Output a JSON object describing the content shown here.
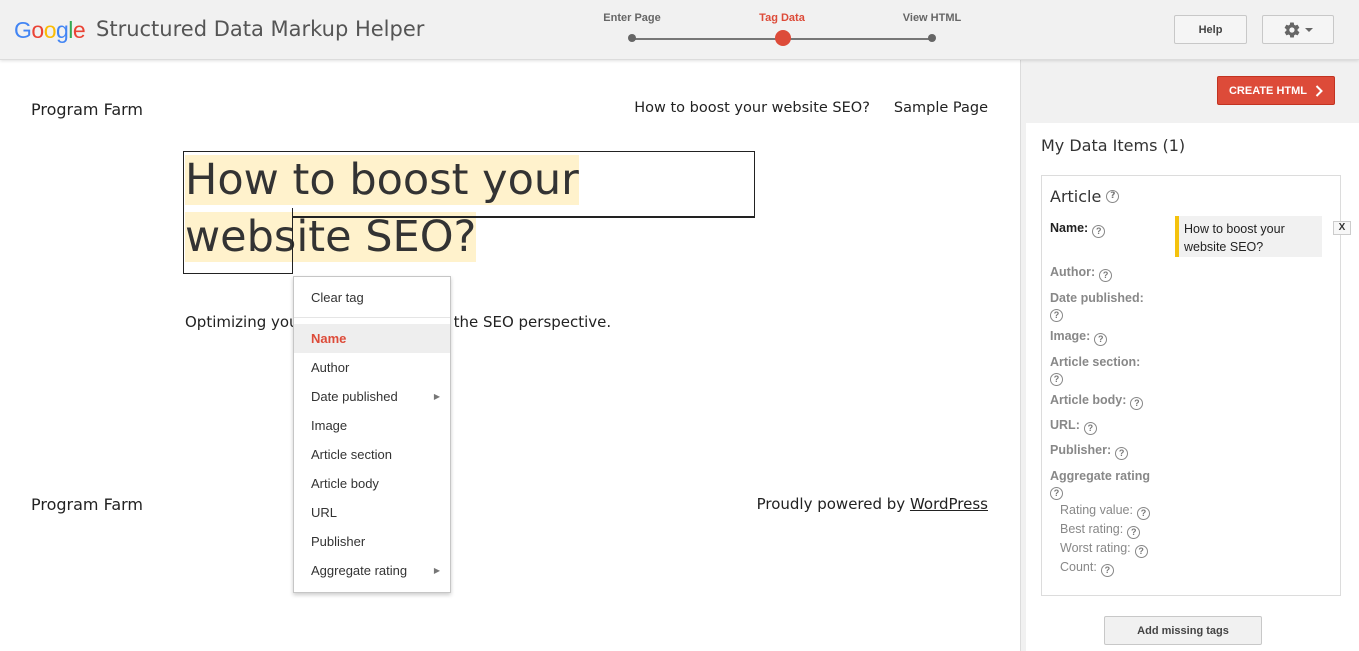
{
  "header": {
    "logo_letters": [
      {
        "char": "G",
        "color": "#4285F4"
      },
      {
        "char": "o",
        "color": "#EA4335"
      },
      {
        "char": "o",
        "color": "#FBBC05"
      },
      {
        "char": "g",
        "color": "#4285F4"
      },
      {
        "char": "l",
        "color": "#34A853"
      },
      {
        "char": "e",
        "color": "#EA4335"
      }
    ],
    "app_title": "Structured Data Markup Helper",
    "steps": [
      "Enter Page",
      "Tag Data",
      "View HTML"
    ],
    "active_step": "Tag Data",
    "help_label": "Help",
    "settings_icon": "gear-icon"
  },
  "preview": {
    "site_title": "Program Farm",
    "nav": [
      "How to boost your website SEO?",
      "Sample Page"
    ],
    "headline": "How to boost your website SEO?",
    "excerpt_start": "Optimizing you",
    "excerpt_end": "the SEO perspective.",
    "footer_left": "Program Farm",
    "footer_right_text": "Proudly powered by ",
    "footer_right_link": "WordPress"
  },
  "context_menu": {
    "clear_label": "Clear tag",
    "items": [
      {
        "label": "Name",
        "selected": true,
        "submenu": false
      },
      {
        "label": "Author",
        "selected": false,
        "submenu": false
      },
      {
        "label": "Date published",
        "selected": false,
        "submenu": true
      },
      {
        "label": "Image",
        "selected": false,
        "submenu": false
      },
      {
        "label": "Article section",
        "selected": false,
        "submenu": false
      },
      {
        "label": "Article body",
        "selected": false,
        "submenu": false
      },
      {
        "label": "URL",
        "selected": false,
        "submenu": false
      },
      {
        "label": "Publisher",
        "selected": false,
        "submenu": false
      },
      {
        "label": "Aggregate rating",
        "selected": false,
        "submenu": true
      }
    ]
  },
  "panel": {
    "create_label": "CREATE HTML",
    "items_title": "My Data Items (1)",
    "card_title": "Article",
    "name_label": "Name:",
    "name_value": "How to boost your website SEO?",
    "remove_label": "X",
    "props": {
      "author": "Author:",
      "date_published": "Date published:",
      "image": "Image:",
      "article_section": "Article section:",
      "article_body": "Article body:",
      "url": "URL:",
      "publisher": "Publisher:",
      "aggregate_rating": "Aggregate rating"
    },
    "sub_props": {
      "rating_value": "Rating value:",
      "best_rating": "Best rating:",
      "worst_rating": "Worst rating:",
      "count": "Count:"
    },
    "add_missing_label": "Add missing tags",
    "help_mark": "?"
  },
  "colors": {
    "accent_red": "#dd4b39",
    "highlight": "#fff2cc",
    "value_marker": "#f4c20d"
  }
}
